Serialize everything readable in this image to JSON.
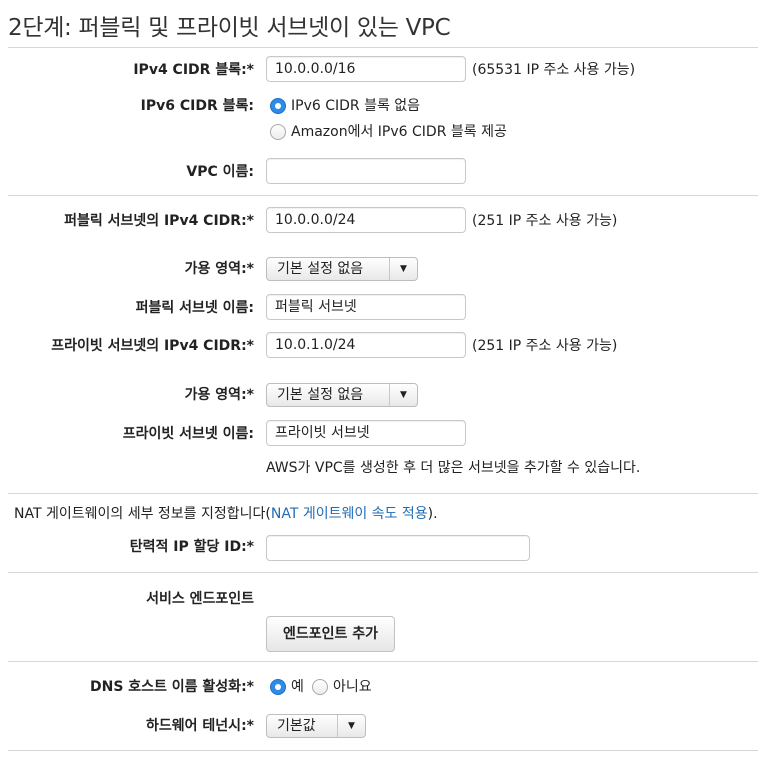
{
  "title": "2단계: 퍼블릭 및 프라이빗 서브넷이 있는 VPC",
  "vpc": {
    "ipv4_label": "IPv4 CIDR 블록:*",
    "ipv4_value": "10.0.0.0/16",
    "ipv4_hint": "(65531 IP 주소 사용 가능)",
    "ipv6_label": "IPv6 CIDR 블록:",
    "ipv6_options": [
      "IPv6 CIDR 블록 없음",
      "Amazon에서 IPv6 CIDR 블록 제공"
    ],
    "ipv6_selected": "IPv6 CIDR 블록 없음",
    "name_label": "VPC 이름:",
    "name_value": ""
  },
  "public_subnet": {
    "cidr_label": "퍼블릭 서브넷의 IPv4 CIDR:*",
    "cidr_value": "10.0.0.0/24",
    "cidr_hint": "(251 IP 주소 사용 가능)",
    "az_label": "가용 영역:*",
    "az_value": "기본 설정 없음",
    "name_label": "퍼블릭 서브넷 이름:",
    "name_value": "퍼블릭 서브넷"
  },
  "private_subnet": {
    "cidr_label": "프라이빗 서브넷의 IPv4 CIDR:*",
    "cidr_value": "10.0.1.0/24",
    "cidr_hint": "(251 IP 주소 사용 가능)",
    "az_label": "가용 영역:*",
    "az_value": "기본 설정 없음",
    "name_label": "프라이빗 서브넷 이름:",
    "name_value": "프라이빗 서브넷",
    "note": "AWS가 VPC를 생성한 후 더 많은 서브넷을 추가할 수 있습니다."
  },
  "nat": {
    "text_prefix": "NAT 게이트웨이의 세부 정보를 지정합니다(",
    "link": "NAT 게이트웨이 속도 적용",
    "text_suffix": ").",
    "eip_label": "탄력적 IP 할당 ID:*",
    "eip_value": ""
  },
  "endpoints": {
    "label": "서비스 엔드포인트",
    "button": "엔드포인트 추가"
  },
  "dns": {
    "label": "DNS 호스트 이름 활성화:*",
    "options": [
      "예",
      "아니요"
    ],
    "selected": "예"
  },
  "tenancy": {
    "label": "하드웨어 테넌시:*",
    "value": "기본값"
  },
  "colors": {
    "link": "#1f6bb5",
    "radio_selected": "#2e8be8",
    "divider": "#d6d6d6"
  }
}
